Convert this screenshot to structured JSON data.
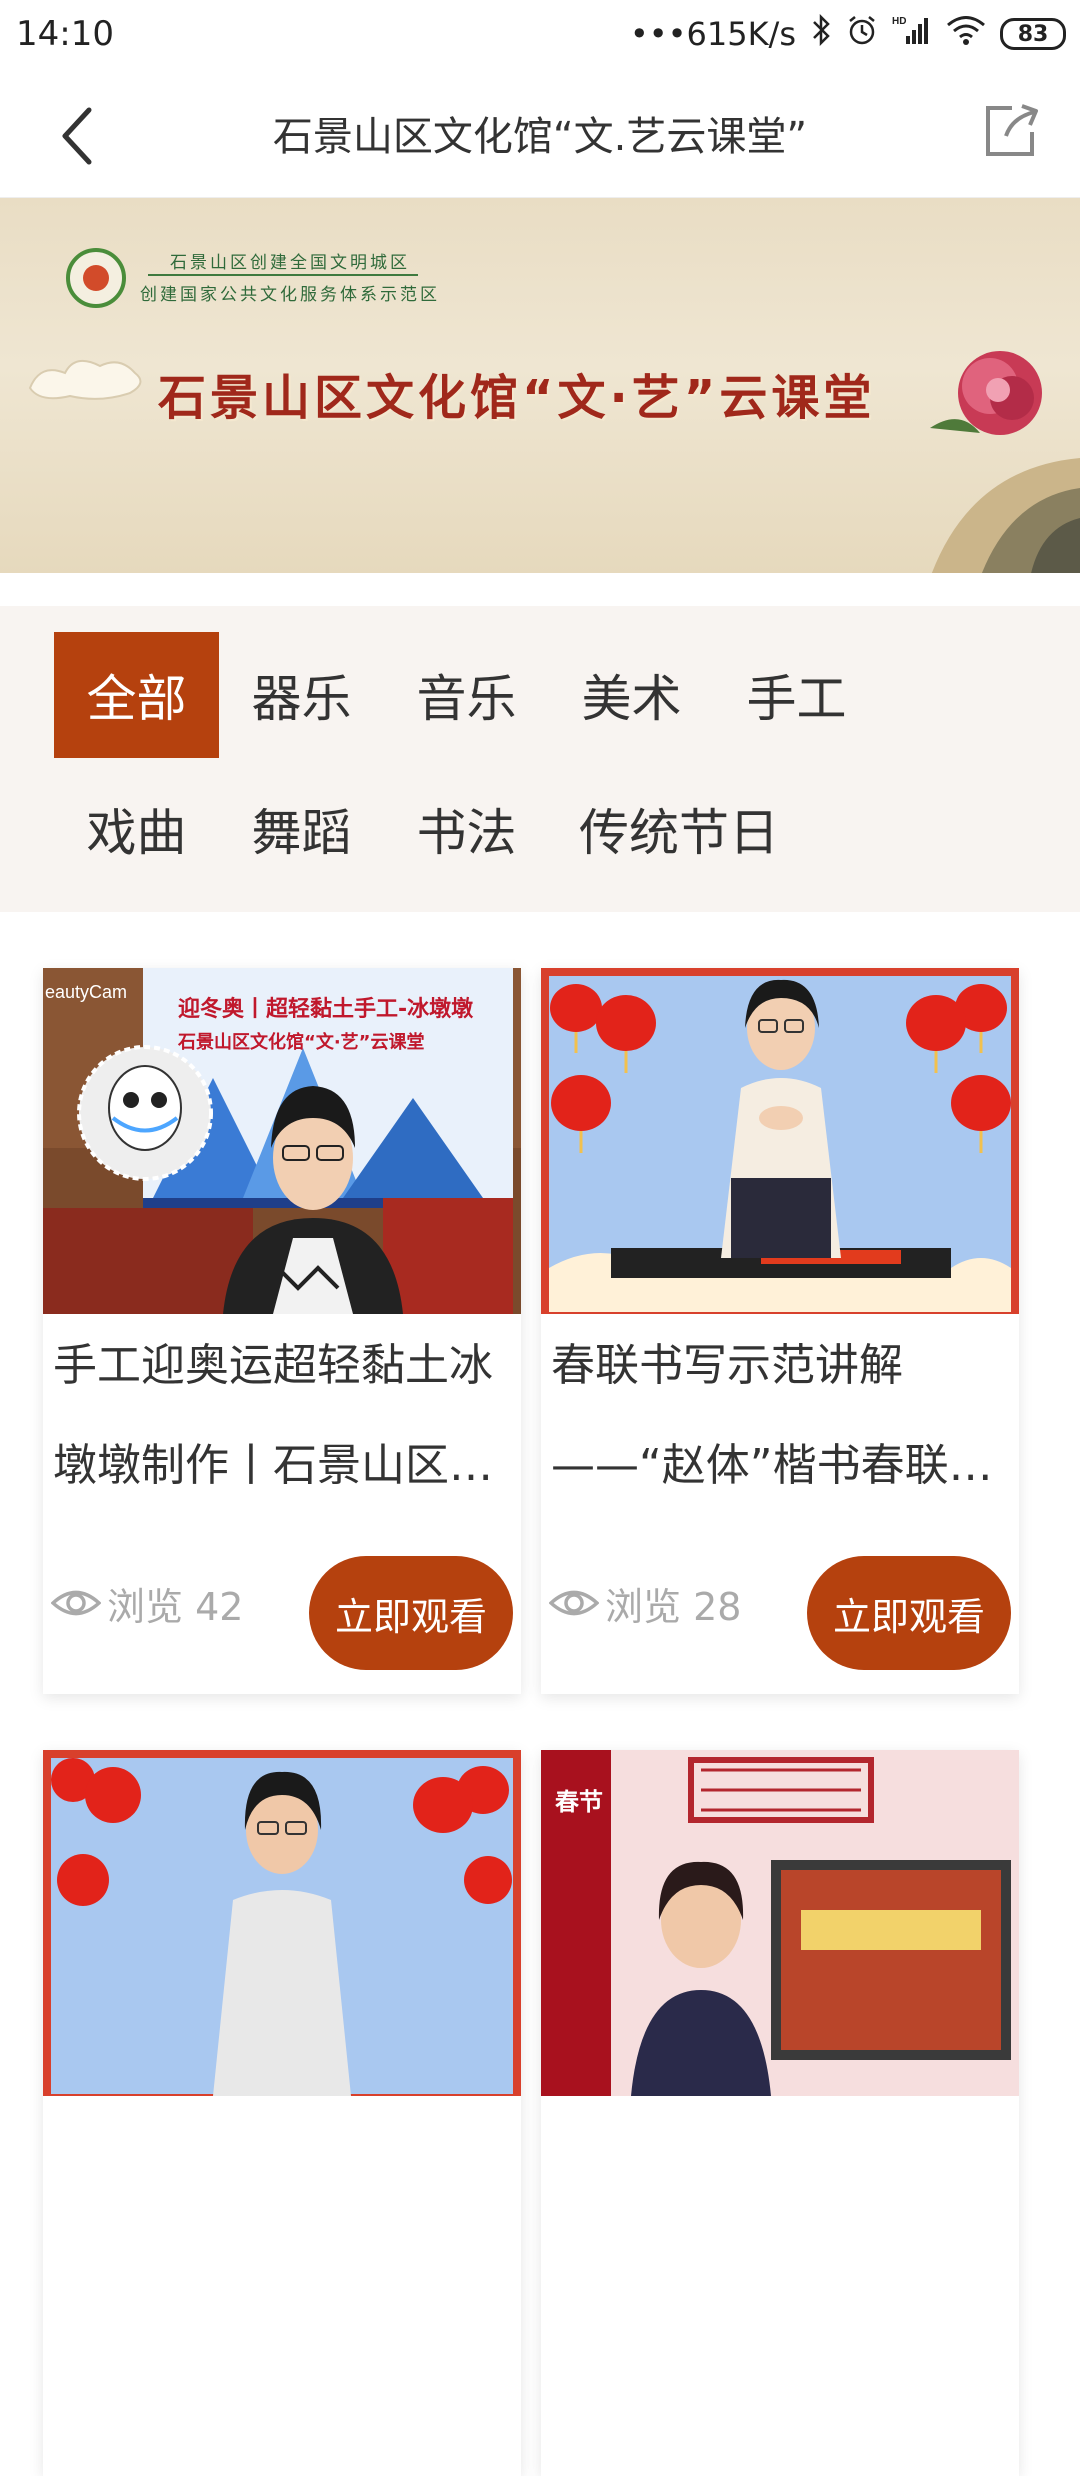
{
  "status": {
    "time": "14:10",
    "network_speed": "•••615K/s",
    "battery": "83"
  },
  "nav": {
    "title": "石景山区文化馆“文.艺云课堂”"
  },
  "banner": {
    "subtitle_line1": "石景山区创建全国文明城区",
    "subtitle_line2": "创建国家公共文化服务体系示范区",
    "main_title": "石景山区文化馆“文·艺”云课堂"
  },
  "categories": [
    {
      "label": "全部",
      "active": true
    },
    {
      "label": "器乐",
      "active": false
    },
    {
      "label": "音乐",
      "active": false
    },
    {
      "label": "美术",
      "active": false
    },
    {
      "label": "手工",
      "active": false
    },
    {
      "label": "戏曲",
      "active": false
    },
    {
      "label": "舞蹈",
      "active": false
    },
    {
      "label": "书法",
      "active": false
    },
    {
      "label": "传统节日",
      "active": false
    }
  ],
  "cards": [
    {
      "title": "手工迎奥运超轻黏土冰墩墩制作丨石景山区文化馆“文·艺”云课堂",
      "thumb_caption_1": "迎冬奥丨超轻黏土手工-冰墩墩",
      "thumb_caption_2": "石景山区文化馆“文·艺”云课堂",
      "thumb_corner": "eautyCam",
      "views_label": "浏览 42",
      "button": "立即观看"
    },
    {
      "title": "春联书写示范讲解——“赵体”楷书春联书写",
      "views_label": "浏览 28",
      "button": "立即观看"
    },
    {
      "title": "",
      "views_label": "",
      "button": ""
    },
    {
      "title": "",
      "thumb_badge": "春节",
      "views_label": "",
      "button": ""
    }
  ],
  "colors": {
    "accent": "#b5410e",
    "filter_bg": "#f8f4f1",
    "muted_text": "#aaaaaa"
  }
}
